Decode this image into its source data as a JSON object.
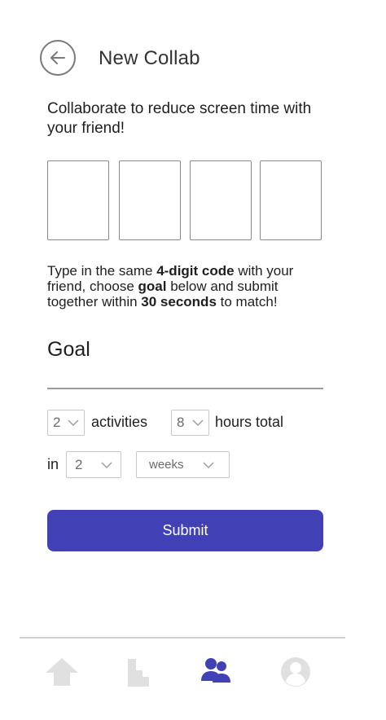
{
  "header": {
    "title": "New Collab",
    "back_icon": "arrow-left-circle-icon"
  },
  "intro": "Collaborate to reduce screen time with your friend!",
  "code": {
    "boxes": [
      "",
      "",
      "",
      ""
    ]
  },
  "instructions": {
    "p1": "Type in the same ",
    "b1": "4-digit code",
    "p2": " with your friend, choose ",
    "b2": "goal",
    "p3": " below and submit together within ",
    "b3": "30 seconds",
    "p4": " to match!"
  },
  "goal": {
    "title": "Goal",
    "activities_value": "2",
    "activities_label": "activities",
    "hours_value": "8",
    "hours_label": "hours total",
    "in_label": "in",
    "period_value": "2",
    "unit_value": "weeks"
  },
  "submit_label": "Submit",
  "nav": {
    "items": [
      "home-icon",
      "stats-icon",
      "collab-icon",
      "profile-icon"
    ],
    "active_color": "#4240b5",
    "inactive_color": "#e0e0e0"
  },
  "colors": {
    "accent": "#4240b5"
  }
}
